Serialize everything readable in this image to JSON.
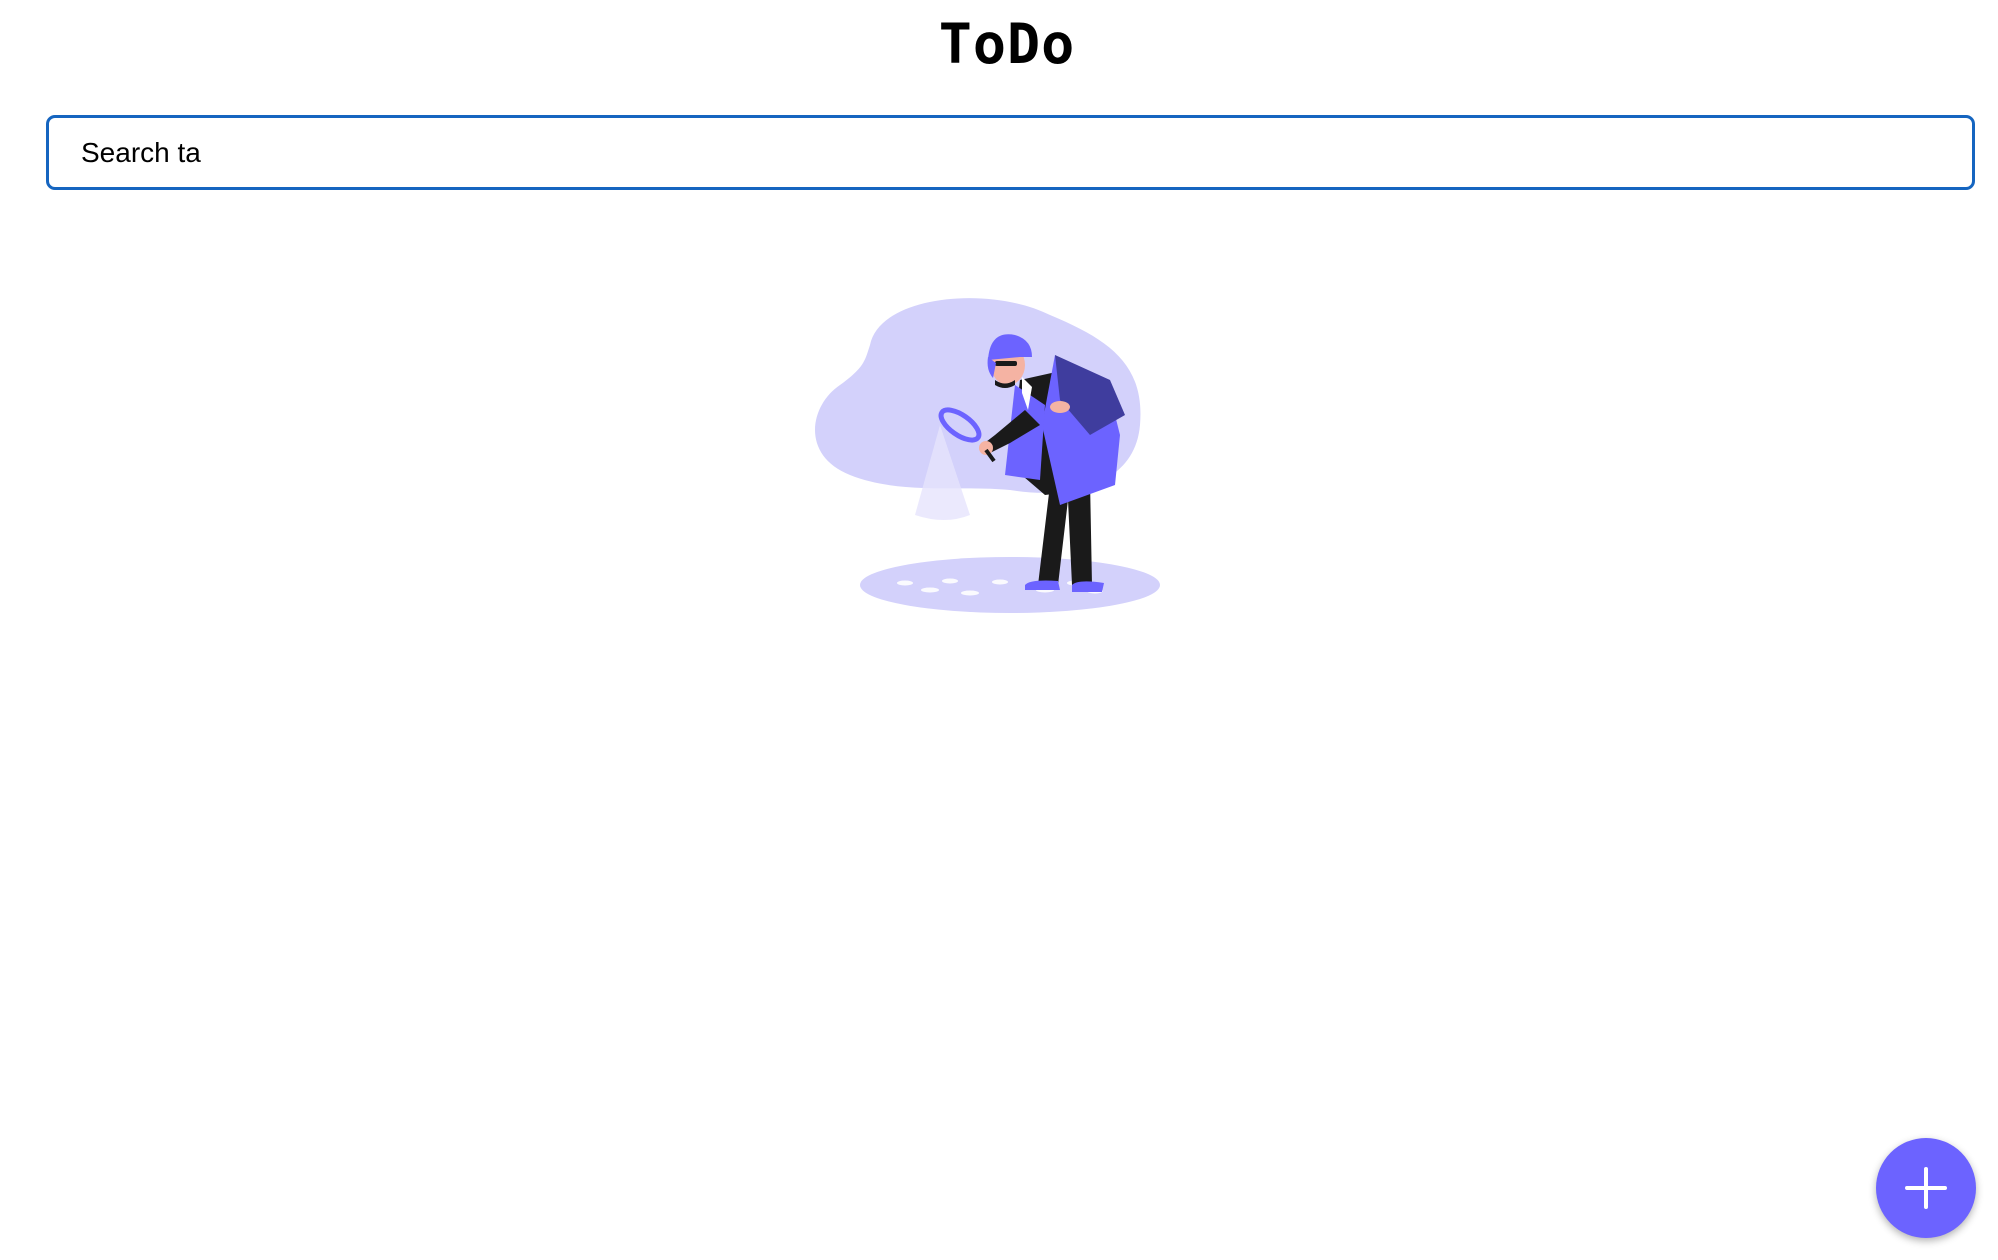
{
  "header": {
    "title": "ToDo"
  },
  "search": {
    "value": "Search ta"
  },
  "empty_state": {
    "icon": "detective-magnifier-illustration"
  },
  "fab": {
    "icon": "plus-icon",
    "color": "#6c63ff"
  },
  "colors": {
    "accent": "#6c63ff",
    "focus_border": "#1565c0",
    "illustration_blob": "#d3d1fb"
  }
}
